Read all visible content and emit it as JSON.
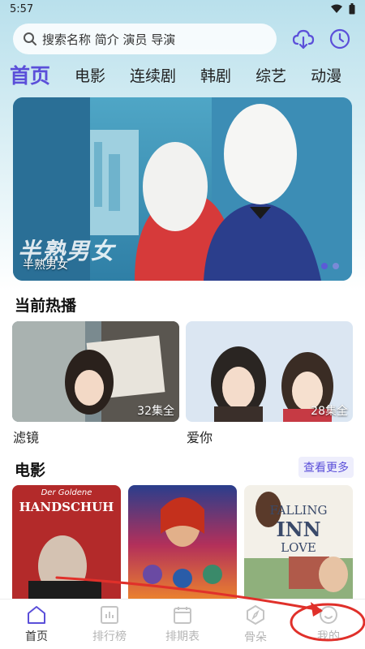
{
  "status_bar": {
    "time": "5:57"
  },
  "search": {
    "placeholder": "搜索名称 简介 演员 导演"
  },
  "tabs": [
    {
      "label": "首页"
    },
    {
      "label": "电影"
    },
    {
      "label": "连续剧"
    },
    {
      "label": "韩剧"
    },
    {
      "label": "综艺"
    },
    {
      "label": "动漫"
    }
  ],
  "banner": {
    "overlay_title": "半熟男女",
    "caption": "半熟男女"
  },
  "hot": {
    "title": "当前热播",
    "items": [
      {
        "title": "滤镜",
        "episodes": "32集全"
      },
      {
        "title": "爱你",
        "episodes": "28集全"
      }
    ]
  },
  "movies": {
    "title": "电影",
    "more_label": "查看更多",
    "posters": [
      {
        "line1": "Der Goldene",
        "line2": "HANDSCHUH"
      },
      {
        "line1": ""
      },
      {
        "line1": "FALLING",
        "line2": "INN",
        "line3": "LOVE"
      }
    ]
  },
  "bottom_nav": [
    {
      "label": "首页",
      "icon": "home-icon"
    },
    {
      "label": "排行榜",
      "icon": "chart-icon"
    },
    {
      "label": "排期表",
      "icon": "calendar-icon"
    },
    {
      "label": "骨朵",
      "icon": "compass-icon"
    },
    {
      "label": "我的",
      "icon": "smile-icon"
    }
  ],
  "colors": {
    "accent": "#5b4fd9",
    "annotation": "#e0302a"
  }
}
